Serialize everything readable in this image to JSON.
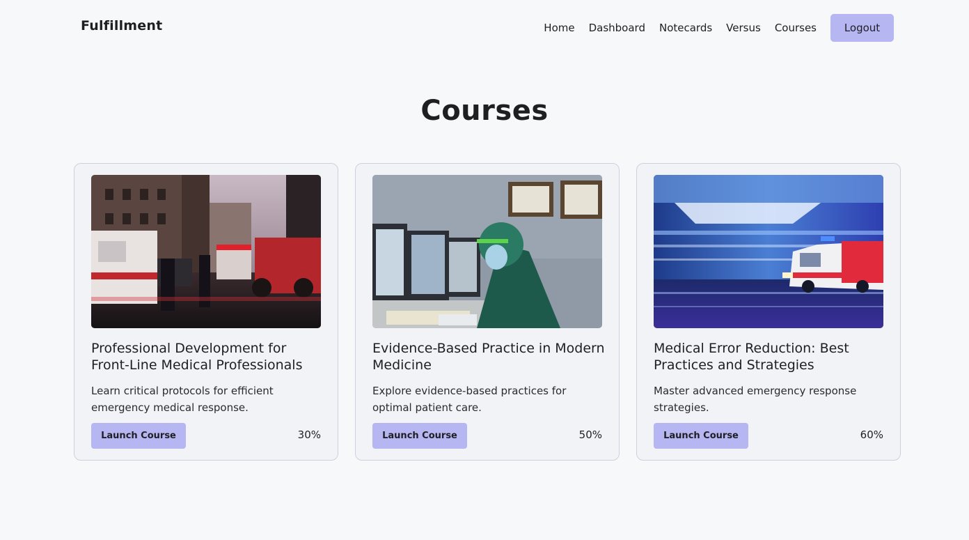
{
  "nav": {
    "brand": "Fulfillment",
    "links": [
      "Home",
      "Dashboard",
      "Notecards",
      "Versus",
      "Courses"
    ],
    "logout_label": "Logout"
  },
  "page": {
    "title": "Courses"
  },
  "courses": [
    {
      "title": "Professional Development for Front-Line Medical Professionals",
      "description": "Learn critical protocols for efficient emergency medical response.",
      "button_label": "Launch Course",
      "progress_label": "30%",
      "progress": 0.3,
      "image": "fdny-ambulance-night-street-photo"
    },
    {
      "title": "Evidence-Based Practice in Modern Medicine",
      "description": "Explore evidence-based practices for optimal patient care.",
      "button_label": "Launch Course",
      "progress_label": "50%",
      "progress": 0.5,
      "image": "surgeon-at-monitors-photo"
    },
    {
      "title": "Medical Error Reduction: Best Practices and Strategies",
      "description": "Master advanced emergency response strategies.",
      "button_label": "Launch Course",
      "progress_label": "60%",
      "progress": 0.6,
      "image": "speeding-ambulance-motion-blur-photo"
    }
  ],
  "colors": {
    "accent": "#b6b6f3",
    "background": "#f7f8f9",
    "card_background": "#f2f3f6",
    "card_border": "#cfd0dc",
    "text": "#1f1f23"
  }
}
